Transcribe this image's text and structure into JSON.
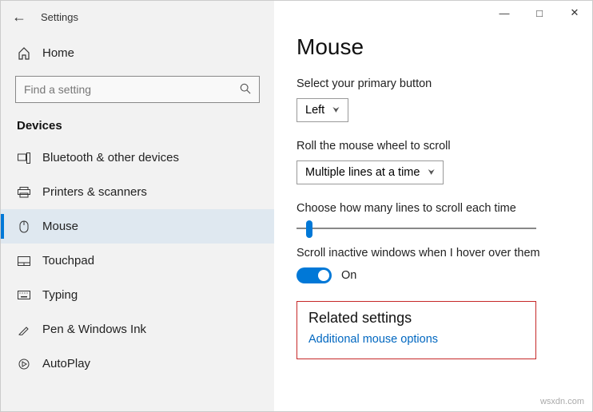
{
  "app_title": "Settings",
  "sidebar": {
    "home_label": "Home",
    "search_placeholder": "Find a setting",
    "section_header": "Devices",
    "items": [
      {
        "label": "Bluetooth & other devices"
      },
      {
        "label": "Printers & scanners"
      },
      {
        "label": "Mouse"
      },
      {
        "label": "Touchpad"
      },
      {
        "label": "Typing"
      },
      {
        "label": "Pen & Windows Ink"
      },
      {
        "label": "AutoPlay"
      }
    ]
  },
  "main": {
    "page_title": "Mouse",
    "primary_button": {
      "label": "Select your primary button",
      "value": "Left"
    },
    "scroll_wheel": {
      "label": "Roll the mouse wheel to scroll",
      "value": "Multiple lines at a time"
    },
    "lines_per_scroll": {
      "label": "Choose how many lines to scroll each time"
    },
    "inactive_scroll": {
      "label": "Scroll inactive windows when I hover over them",
      "value": "On"
    },
    "related": {
      "title": "Related settings",
      "link": "Additional mouse options"
    }
  },
  "watermark": "wsxdn.com"
}
